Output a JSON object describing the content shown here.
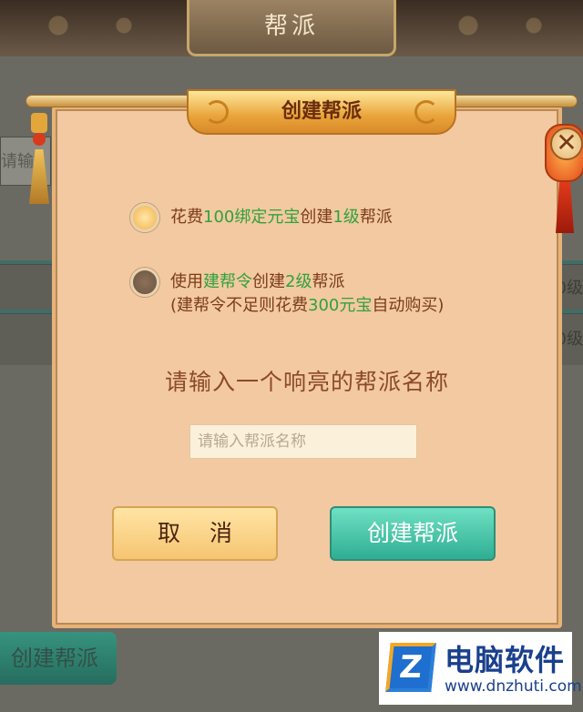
{
  "background": {
    "title": "帮派",
    "input_fragment": "请输",
    "side_values": [
      "0级",
      "0级"
    ],
    "create_button": "创建帮派"
  },
  "modal": {
    "title": "创建帮派",
    "close_glyph": "✕",
    "option1": {
      "selected": true,
      "parts": [
        "花费",
        "100绑定元宝",
        "创建",
        "1级",
        "帮派"
      ]
    },
    "option2": {
      "selected": false,
      "line1": [
        "使用",
        "建帮令",
        "创建",
        "2级",
        "帮派"
      ],
      "line2": [
        "(建帮令不足则花费",
        "300元宝",
        "自动购买)"
      ]
    },
    "prompt": "请输入一个响亮的帮派名称",
    "name_input": {
      "placeholder": "请输入帮派名称",
      "value": ""
    },
    "cancel_label": "取 消",
    "confirm_label": "创建帮派"
  },
  "watermark": {
    "logo_letter": "Z",
    "title": "电脑软件",
    "url": "www.dnzhuti.com"
  },
  "colors": {
    "accent_green": "#2fa23c",
    "modal_bg": "#f3c9a1",
    "create_button": "#2fae93",
    "cancel_button": "#f6c572"
  }
}
